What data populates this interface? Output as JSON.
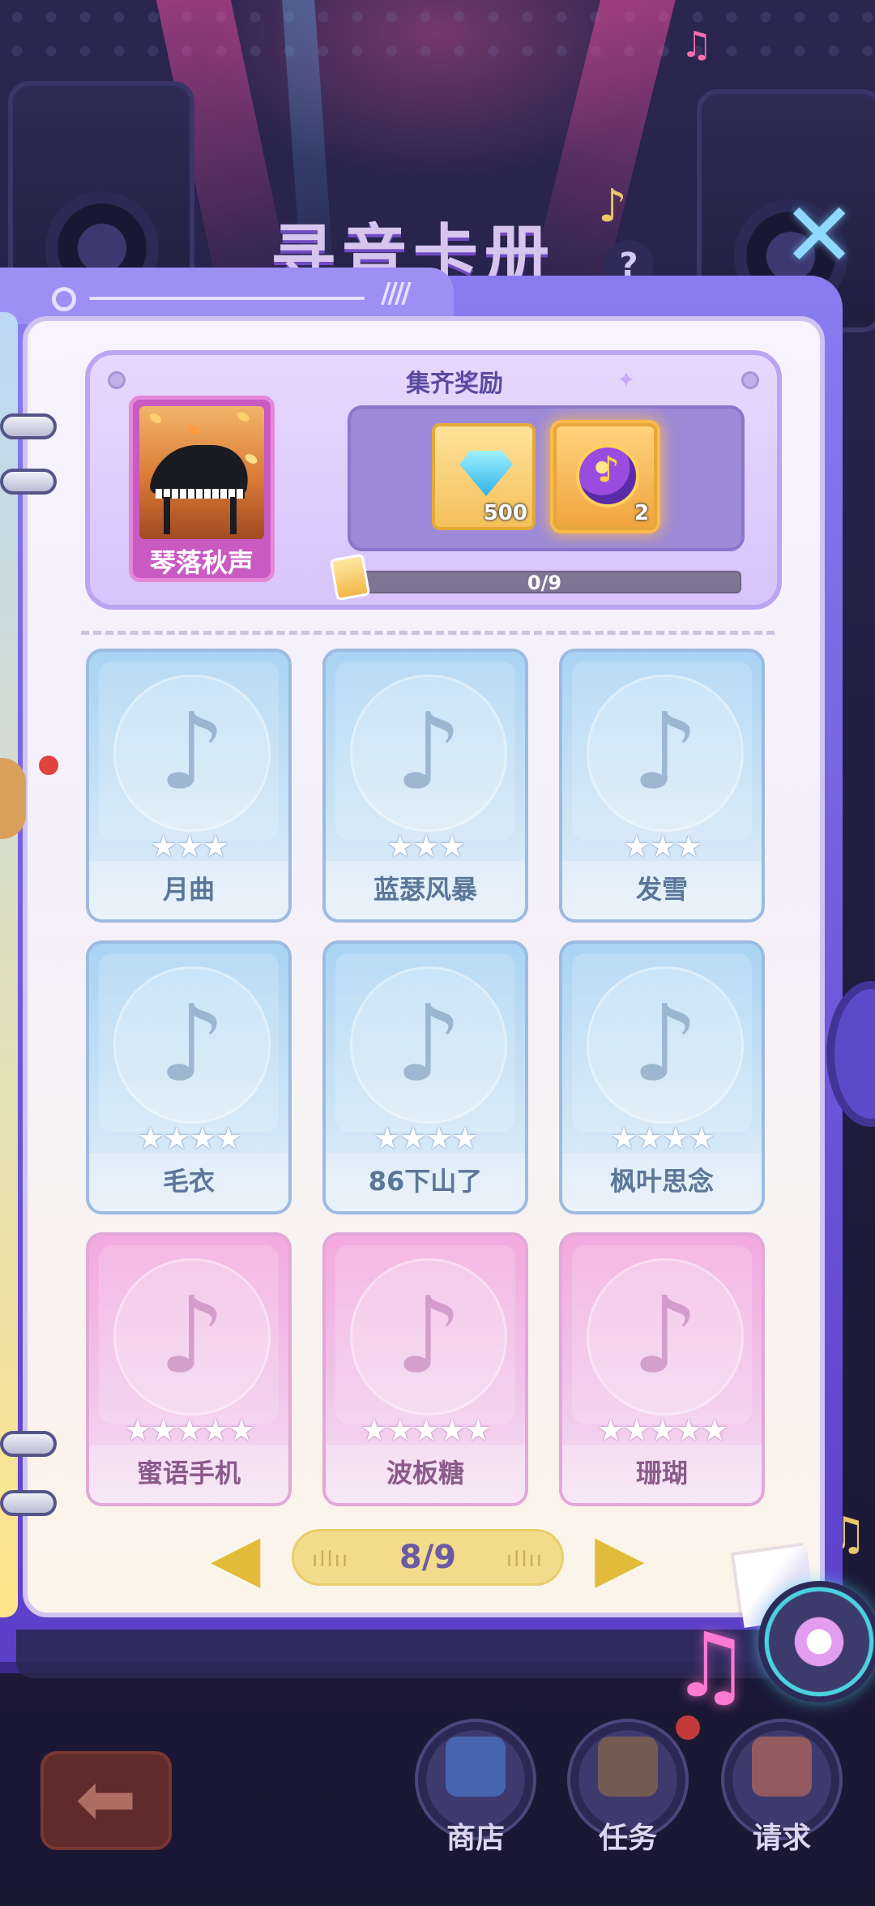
{
  "background": {
    "title": "寻音卡册",
    "help_symbol": "?"
  },
  "collection": {
    "song_name": "琴落秋声",
    "reward_title": "集齐奖励",
    "rewards": [
      {
        "icon": "diamond-icon",
        "count": "500"
      },
      {
        "icon": "music-orb-icon",
        "count": "2"
      }
    ],
    "progress_text": "0/9",
    "progress_value": 0
  },
  "cards": [
    {
      "name": "月曲",
      "stars": "★★★",
      "color": "blue"
    },
    {
      "name": "蓝瑟风暴",
      "stars": "★★★",
      "color": "blue"
    },
    {
      "name": "发雪",
      "stars": "★★★",
      "color": "blue"
    },
    {
      "name": "毛衣",
      "stars": "★★★★",
      "color": "blue"
    },
    {
      "name": "86下山了",
      "stars": "★★★★",
      "color": "blue"
    },
    {
      "name": "枫叶思念",
      "stars": "★★★★",
      "color": "blue"
    },
    {
      "name": "蜜语手机",
      "stars": "★★★★★",
      "color": "pink"
    },
    {
      "name": "波板糖",
      "stars": "★★★★★",
      "color": "pink"
    },
    {
      "name": "珊瑚",
      "stars": "★★★★★",
      "color": "pink"
    }
  ],
  "pager": {
    "text": "8/9",
    "prev_symbol": "◀",
    "next_symbol": "▶",
    "wave": "ıllıı"
  },
  "nav": {
    "shop": "商店",
    "tasks": "任务",
    "request": "请求"
  },
  "symbols": {
    "close": "✕",
    "back": "⬅",
    "note": "♪",
    "double_note": "♫"
  }
}
